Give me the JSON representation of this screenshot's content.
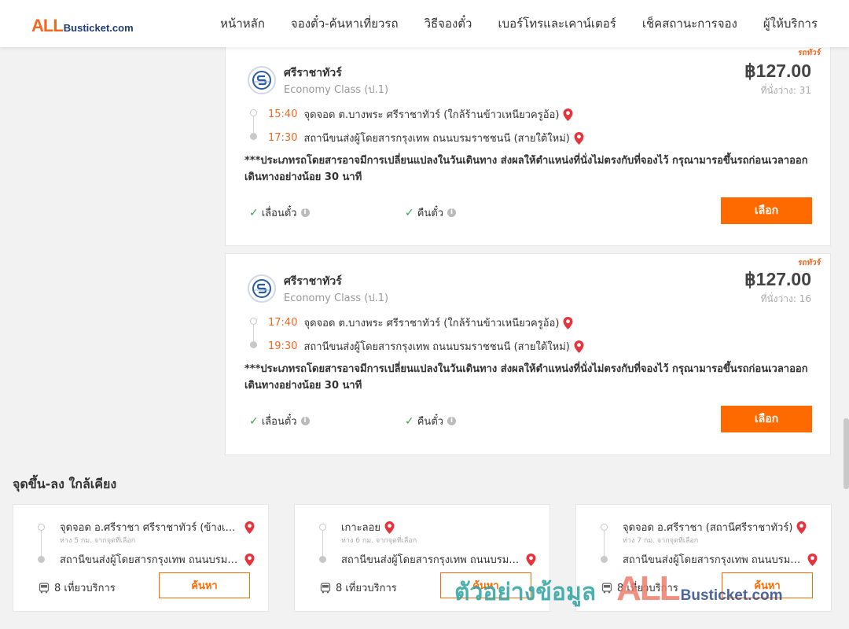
{
  "header": {
    "logo_all": "ALL",
    "logo_rest": "Busticket.com",
    "nav": [
      "หน้าหลัก",
      "จองตั๋ว-ค้นหาเที่ยวรถ",
      "วิธีจองตั๋ว",
      "เบอร์โทรและเคาน์เตอร์",
      "เช็คสถานะการจอง",
      "ผู้ให้บริการ"
    ]
  },
  "trips": [
    {
      "tag": "รถทัวร์",
      "operator": "ศรีราชาทัวร์",
      "class": "Economy Class (ป.1)",
      "price": "฿127.00",
      "seats": "ที่นั่งว่าง: 31",
      "depart_time": "15:40",
      "depart_place": "จุดจอด ต.บางพระ ศรีราชาทัวร์ (ใกล้ร้านข้าวเหนียวครูอ้อ)",
      "arrive_time": "17:30",
      "arrive_place": "สถานีขนส่งผู้โดยสารกรุงเทพ ถนนบรมราชชนนี (สายใต้ใหม่)",
      "notice": "***ประเภทรถโดยสารอาจมีการเปลี่ยนแปลงในวันเดินทาง ส่งผลให้ตำแหน่งที่นั่งไม่ตรงกับที่จองไว้ กรุณามารอขึ้นรถก่อนเวลาออกเดินทางอย่างน้อย 30 นาที",
      "feature1": "เลื่อนตั๋ว",
      "feature2": "คืนตั๋ว",
      "button": "เลือก"
    },
    {
      "tag": "รถทัวร์",
      "operator": "ศรีราชาทัวร์",
      "class": "Economy Class (ป.1)",
      "price": "฿127.00",
      "seats": "ที่นั่งว่าง: 16",
      "depart_time": "17:40",
      "depart_place": "จุดจอด ต.บางพระ ศรีราชาทัวร์ (ใกล้ร้านข้าวเหนียวครูอ้อ)",
      "arrive_time": "19:30",
      "arrive_place": "สถานีขนส่งผู้โดยสารกรุงเทพ ถนนบรมราชชนนี (สายใต้ใหม่)",
      "notice": "***ประเภทรถโดยสารอาจมีการเปลี่ยนแปลงในวันเดินทาง ส่งผลให้ตำแหน่งที่นั่งไม่ตรงกับที่จองไว้ กรุณามารอขึ้นรถก่อนเวลาออกเดินทางอย่างน้อย 30 นาที",
      "feature1": "เลื่อนตั๋ว",
      "feature2": "คืนตั๋ว",
      "button": "เลือก"
    }
  ],
  "nearby": {
    "title": "จุดขึ้น-ลง ใกล้เคียง",
    "cards": [
      {
        "from": "จุดจอด อ.ศรีราชา ศรีราชาทัวร์ (ข้างเซ็...",
        "distance": "ห่าง 5 กม. จากจุดที่เลือก",
        "to": "สถานีขนส่งผู้โดยสารกรุงเทพ ถนนบรมร...",
        "count": "8 เที่ยวบริการ",
        "button": "ค้นหา"
      },
      {
        "from": "เกาะลอย",
        "distance": "ห่าง 6 กม. จากจุดที่เลือก",
        "to": "สถานีขนส่งผู้โดยสารกรุงเทพ ถนนบรมร...",
        "count": "8 เที่ยวบริการ",
        "button": "ค้นหา"
      },
      {
        "from": "จุดจอด อ.ศรีราชา (สถานีศรีราชาทัวร์)",
        "distance": "ห่าง 7 กม. จากจุดที่เลือก",
        "to": "สถานีขนส่งผู้โดยสารกรุงเทพ ถนนบรมร...",
        "count": "8 เที่ยวบริการ",
        "button": "ค้นหา"
      }
    ]
  },
  "watermark": {
    "thai": "ตัวอย่างข้อมูล",
    "all": "ALL",
    "rest": "Busticket.com"
  },
  "colors": {
    "accent": "#ff6a00",
    "time": "#f26722",
    "check": "#3aa34d",
    "pin": "#e8333c",
    "logo_blue": "#1d3c78"
  }
}
